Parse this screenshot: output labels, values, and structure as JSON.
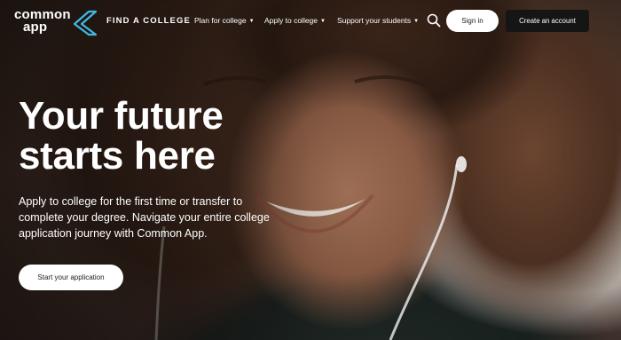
{
  "header": {
    "logo": {
      "line1": "common",
      "line2": "app"
    },
    "find_college": "FIND A COLLEGE",
    "nav": [
      {
        "label": "Plan for college",
        "icon": "caret-down-icon"
      },
      {
        "label": "Apply to college",
        "icon": "caret-down-icon"
      },
      {
        "label": "Support your students",
        "icon": "caret-down-icon"
      }
    ],
    "search_icon": "search-icon",
    "sign_in": "Sign in",
    "create_account": "Create an account"
  },
  "hero": {
    "title_line1": "Your future",
    "title_line2": "starts here",
    "body": "Apply to college for the first time or transfer to complete your degree. Navigate your entire college application journey with Common App.",
    "cta": "Start your application"
  },
  "colors": {
    "logo_accent": "#3fb9e8",
    "button_light": "#ffffff",
    "button_dark": "#151515"
  }
}
